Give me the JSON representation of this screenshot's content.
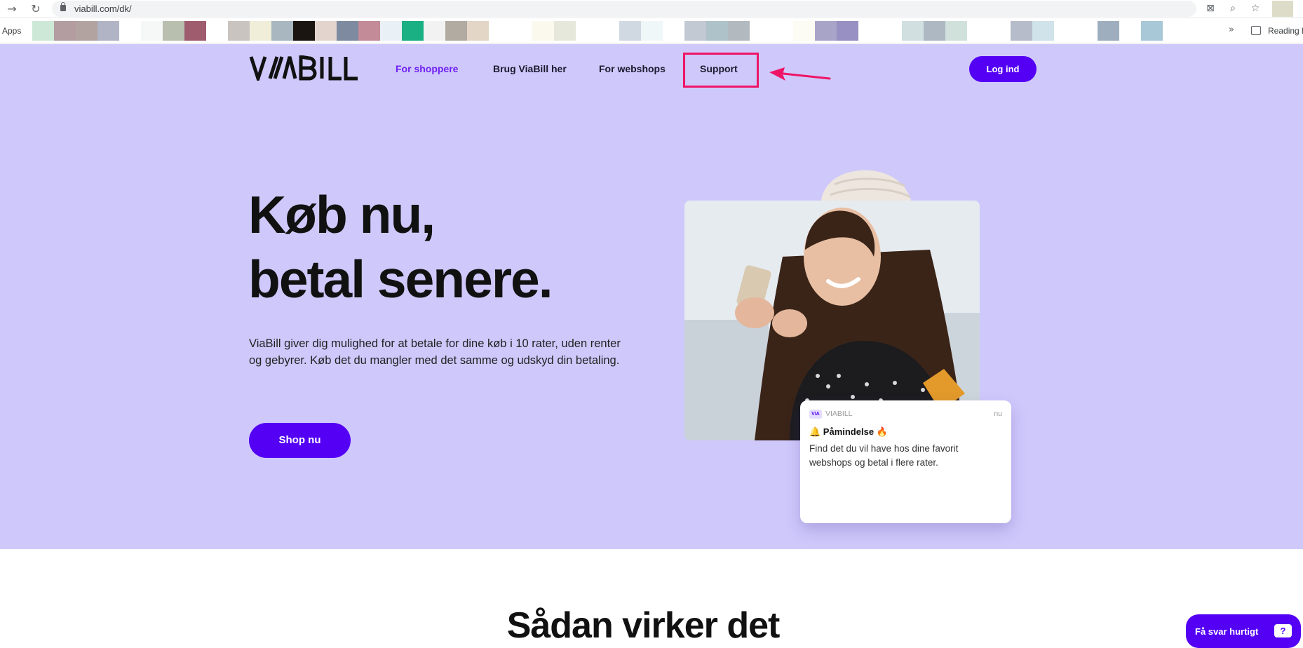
{
  "browser": {
    "url": "viabill.com/dk/",
    "apps_label": "Apps",
    "reading_list_label": "Reading l",
    "bookmark_swatches": [
      "#cde8d6",
      "#b39da1",
      "#b2a3a1",
      "#b1b4c5",
      "#ffffff",
      "#f6f8f8",
      "#b8bfae",
      "#9e5c6e",
      "#ffffff",
      "#cac4c1",
      "#f0eed9",
      "#a8b7c0",
      "#1b1512",
      "#e3d5ce",
      "#7d8aa0",
      "#c38a98",
      "#e9f0f6",
      "#1bb083",
      "#f2f2f2",
      "#b1aba1",
      "#e3d6c7",
      "#ffffff",
      "#ffffff",
      "#fbf9ee",
      "#e7e8dc",
      "#ffffff",
      "#ffffff",
      "#d0d9e1",
      "#f0f7f8",
      "#ffffff",
      "#c2c9d3",
      "#adc3c9",
      "#b2b9bf",
      "#ffffff",
      "#ffffff",
      "#fcfcf4",
      "#a8a4c8",
      "#9890c2",
      "#ffffff",
      "#ffffff",
      "#d1dfe1",
      "#adb8c3",
      "#d0e1dc",
      "#ffffff",
      "#ffffff",
      "#b7bccb",
      "#d0e2ea",
      "#ffffff",
      "#ffffff",
      "#9eaebe",
      "#ffffff",
      "#a8c8d8"
    ]
  },
  "header": {
    "logo_text": "VIABILL",
    "nav": [
      {
        "label": "For shoppere",
        "active": true
      },
      {
        "label": "Brug ViaBill her",
        "active": false
      },
      {
        "label": "For webshops",
        "active": false
      },
      {
        "label": "Support",
        "active": false,
        "highlighted": true
      }
    ],
    "login_label": "Log ind"
  },
  "hero": {
    "headline_line1": "Køb nu,",
    "headline_line2": "betal senere.",
    "lead": "ViaBill giver dig mulighed for at betale for dine køb i 10 rater, uden renter og gebyrer. Køb det du mangler med det samme og udskyd din betaling.",
    "cta_label": "Shop nu",
    "notification": {
      "logo_text": "VIA",
      "app_name": "VIABILL",
      "time": "nu",
      "title": "🔔 Påmindelse 🔥",
      "body": "Find det du vil have hos dine favorit webshops og betal i flere rater."
    }
  },
  "section": {
    "title": "Sådan virker det"
  },
  "chat": {
    "label": "Få svar hurtigt",
    "icon_text": "?"
  },
  "colors": {
    "hero_bg": "#cfc8fb",
    "brand_purple": "#5400f5",
    "active_nav": "#6e1ef4",
    "annotation": "#ee1567"
  }
}
